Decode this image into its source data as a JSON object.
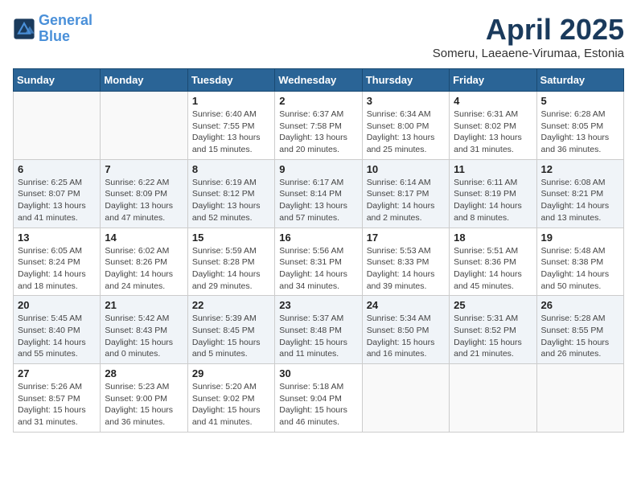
{
  "header": {
    "logo_line1": "General",
    "logo_line2": "Blue",
    "month_title": "April 2025",
    "subtitle": "Someru, Laeaene-Virumaa, Estonia"
  },
  "weekdays": [
    "Sunday",
    "Monday",
    "Tuesday",
    "Wednesday",
    "Thursday",
    "Friday",
    "Saturday"
  ],
  "rows": [
    {
      "cells": [
        {
          "empty": true
        },
        {
          "empty": true
        },
        {
          "day": 1,
          "sunrise": "6:40 AM",
          "sunset": "7:55 PM",
          "daylight": "13 hours and 15 minutes."
        },
        {
          "day": 2,
          "sunrise": "6:37 AM",
          "sunset": "7:58 PM",
          "daylight": "13 hours and 20 minutes."
        },
        {
          "day": 3,
          "sunrise": "6:34 AM",
          "sunset": "8:00 PM",
          "daylight": "13 hours and 25 minutes."
        },
        {
          "day": 4,
          "sunrise": "6:31 AM",
          "sunset": "8:02 PM",
          "daylight": "13 hours and 31 minutes."
        },
        {
          "day": 5,
          "sunrise": "6:28 AM",
          "sunset": "8:05 PM",
          "daylight": "13 hours and 36 minutes."
        }
      ]
    },
    {
      "cells": [
        {
          "day": 6,
          "sunrise": "6:25 AM",
          "sunset": "8:07 PM",
          "daylight": "13 hours and 41 minutes."
        },
        {
          "day": 7,
          "sunrise": "6:22 AM",
          "sunset": "8:09 PM",
          "daylight": "13 hours and 47 minutes."
        },
        {
          "day": 8,
          "sunrise": "6:19 AM",
          "sunset": "8:12 PM",
          "daylight": "13 hours and 52 minutes."
        },
        {
          "day": 9,
          "sunrise": "6:17 AM",
          "sunset": "8:14 PM",
          "daylight": "13 hours and 57 minutes."
        },
        {
          "day": 10,
          "sunrise": "6:14 AM",
          "sunset": "8:17 PM",
          "daylight": "14 hours and 2 minutes."
        },
        {
          "day": 11,
          "sunrise": "6:11 AM",
          "sunset": "8:19 PM",
          "daylight": "14 hours and 8 minutes."
        },
        {
          "day": 12,
          "sunrise": "6:08 AM",
          "sunset": "8:21 PM",
          "daylight": "14 hours and 13 minutes."
        }
      ]
    },
    {
      "cells": [
        {
          "day": 13,
          "sunrise": "6:05 AM",
          "sunset": "8:24 PM",
          "daylight": "14 hours and 18 minutes."
        },
        {
          "day": 14,
          "sunrise": "6:02 AM",
          "sunset": "8:26 PM",
          "daylight": "14 hours and 24 minutes."
        },
        {
          "day": 15,
          "sunrise": "5:59 AM",
          "sunset": "8:28 PM",
          "daylight": "14 hours and 29 minutes."
        },
        {
          "day": 16,
          "sunrise": "5:56 AM",
          "sunset": "8:31 PM",
          "daylight": "14 hours and 34 minutes."
        },
        {
          "day": 17,
          "sunrise": "5:53 AM",
          "sunset": "8:33 PM",
          "daylight": "14 hours and 39 minutes."
        },
        {
          "day": 18,
          "sunrise": "5:51 AM",
          "sunset": "8:36 PM",
          "daylight": "14 hours and 45 minutes."
        },
        {
          "day": 19,
          "sunrise": "5:48 AM",
          "sunset": "8:38 PM",
          "daylight": "14 hours and 50 minutes."
        }
      ]
    },
    {
      "cells": [
        {
          "day": 20,
          "sunrise": "5:45 AM",
          "sunset": "8:40 PM",
          "daylight": "14 hours and 55 minutes."
        },
        {
          "day": 21,
          "sunrise": "5:42 AM",
          "sunset": "8:43 PM",
          "daylight": "15 hours and 0 minutes."
        },
        {
          "day": 22,
          "sunrise": "5:39 AM",
          "sunset": "8:45 PM",
          "daylight": "15 hours and 5 minutes."
        },
        {
          "day": 23,
          "sunrise": "5:37 AM",
          "sunset": "8:48 PM",
          "daylight": "15 hours and 11 minutes."
        },
        {
          "day": 24,
          "sunrise": "5:34 AM",
          "sunset": "8:50 PM",
          "daylight": "15 hours and 16 minutes."
        },
        {
          "day": 25,
          "sunrise": "5:31 AM",
          "sunset": "8:52 PM",
          "daylight": "15 hours and 21 minutes."
        },
        {
          "day": 26,
          "sunrise": "5:28 AM",
          "sunset": "8:55 PM",
          "daylight": "15 hours and 26 minutes."
        }
      ]
    },
    {
      "cells": [
        {
          "day": 27,
          "sunrise": "5:26 AM",
          "sunset": "8:57 PM",
          "daylight": "15 hours and 31 minutes."
        },
        {
          "day": 28,
          "sunrise": "5:23 AM",
          "sunset": "9:00 PM",
          "daylight": "15 hours and 36 minutes."
        },
        {
          "day": 29,
          "sunrise": "5:20 AM",
          "sunset": "9:02 PM",
          "daylight": "15 hours and 41 minutes."
        },
        {
          "day": 30,
          "sunrise": "5:18 AM",
          "sunset": "9:04 PM",
          "daylight": "15 hours and 46 minutes."
        },
        {
          "empty": true
        },
        {
          "empty": true
        },
        {
          "empty": true
        }
      ]
    }
  ]
}
